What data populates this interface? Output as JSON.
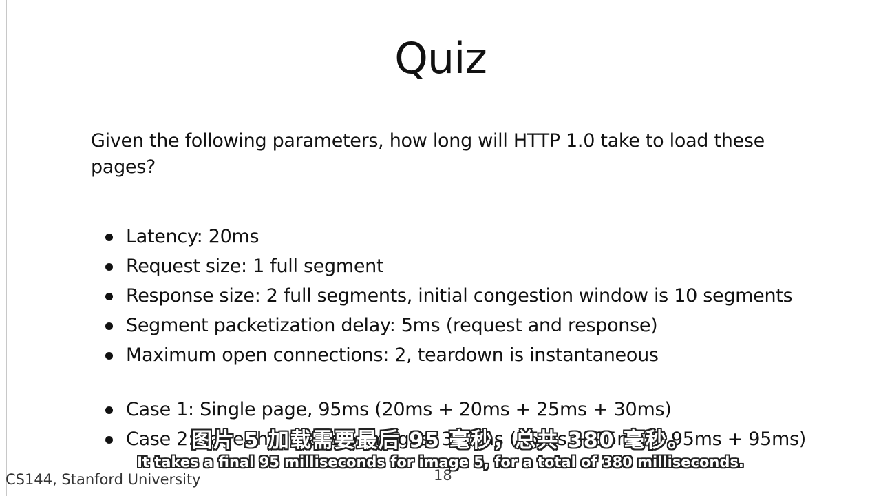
{
  "slide": {
    "title": "Quiz",
    "question": "Given the following parameters, how long will HTTP 1.0 take to load these pages?",
    "parameters": [
      "Latency: 20ms",
      "Request size: 1 full segment",
      "Response size: 2 full segments, initial congestion window is 10 segments",
      "Segment packetization delay: 5ms (request and response)",
      "Maximum open connections: 2, teardown is instantaneous"
    ],
    "cases": [
      "Case 1: Single page, 95ms (20ms + 20ms + 25ms + 30ms)",
      "Case 2: Page that loads 5 images, 380ms (95ms + 95ms + 95ms + 95ms)"
    ],
    "footer": "CS144, Stanford University",
    "page_number": "18"
  },
  "subtitles": {
    "chinese": "图片 5 加载需要最后 95 毫秒，总共 380 毫秒。",
    "english": "It takes a final 95 milliseconds for image 5, for a total of 380 milliseconds."
  }
}
